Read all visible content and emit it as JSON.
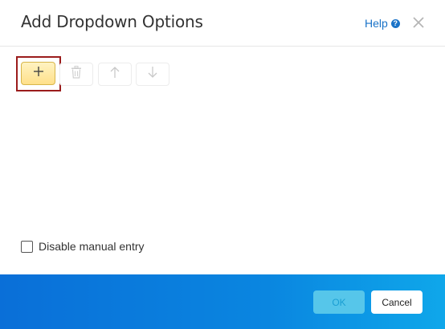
{
  "dialog": {
    "title": "Add Dropdown Options",
    "help_label": "Help",
    "help_icon": "?"
  },
  "toolbar": {
    "buttons": [
      {
        "name": "add",
        "icon": "plus-icon",
        "enabled": true
      },
      {
        "name": "delete",
        "icon": "trash-icon",
        "enabled": false
      },
      {
        "name": "move-up",
        "icon": "arrow-up-icon",
        "enabled": false
      },
      {
        "name": "move-down",
        "icon": "arrow-down-icon",
        "enabled": false
      }
    ]
  },
  "manual_entry": {
    "label": "Disable manual entry",
    "checked": false
  },
  "footer": {
    "ok_label": "OK",
    "cancel_label": "Cancel"
  },
  "colors": {
    "accent": "#1a73c8",
    "highlight_border": "#9b1c1c",
    "footer_gradient_start": "#0a6fd8",
    "footer_gradient_end": "#0fa7ea"
  }
}
